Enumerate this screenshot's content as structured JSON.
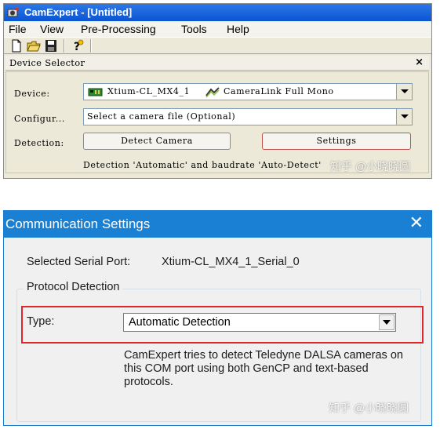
{
  "cam_window": {
    "title": "CamExpert - [Untitled]",
    "menu": [
      "File",
      "View",
      "Pre-Processing",
      "Tools",
      "Help"
    ],
    "toolbar_icons": [
      "new-file-icon",
      "open-folder-icon",
      "save-icon",
      "help-icon"
    ],
    "device_selector": {
      "title": "Device Selector",
      "close": "×",
      "device_label": "Device:",
      "device_value": "Xtium-CL_MX4_1",
      "device_type": "CameraLink Full Mono",
      "config_label": "Configur...",
      "config_value": "Select a camera file (Optional)",
      "detection_label": "Detection:",
      "detect_button": "Detect Camera",
      "settings_button": "Settings",
      "status": "Detection 'Automatic' and baudrate 'Auto-Detect'"
    }
  },
  "comm_window": {
    "title": "Communication Settings",
    "close": "✕",
    "serial_port_label": "Selected Serial Port:",
    "serial_port_value": "Xtium-CL_MX4_1_Serial_0",
    "group_title": "Protocol Detection",
    "type_label": "Type:",
    "type_value": "Automatic Detection",
    "description": "CamExpert tries to detect Teledyne DALSA cameras on this COM port using both GenCP and text-based protocols."
  },
  "watermark": "知乎 @小晓晓圆",
  "colors": {
    "xp_title_blue": "#0a55d2",
    "win10_title_blue": "#1a80d4",
    "highlight_red": "#e0262a",
    "settings_border_red": "#c05050"
  }
}
